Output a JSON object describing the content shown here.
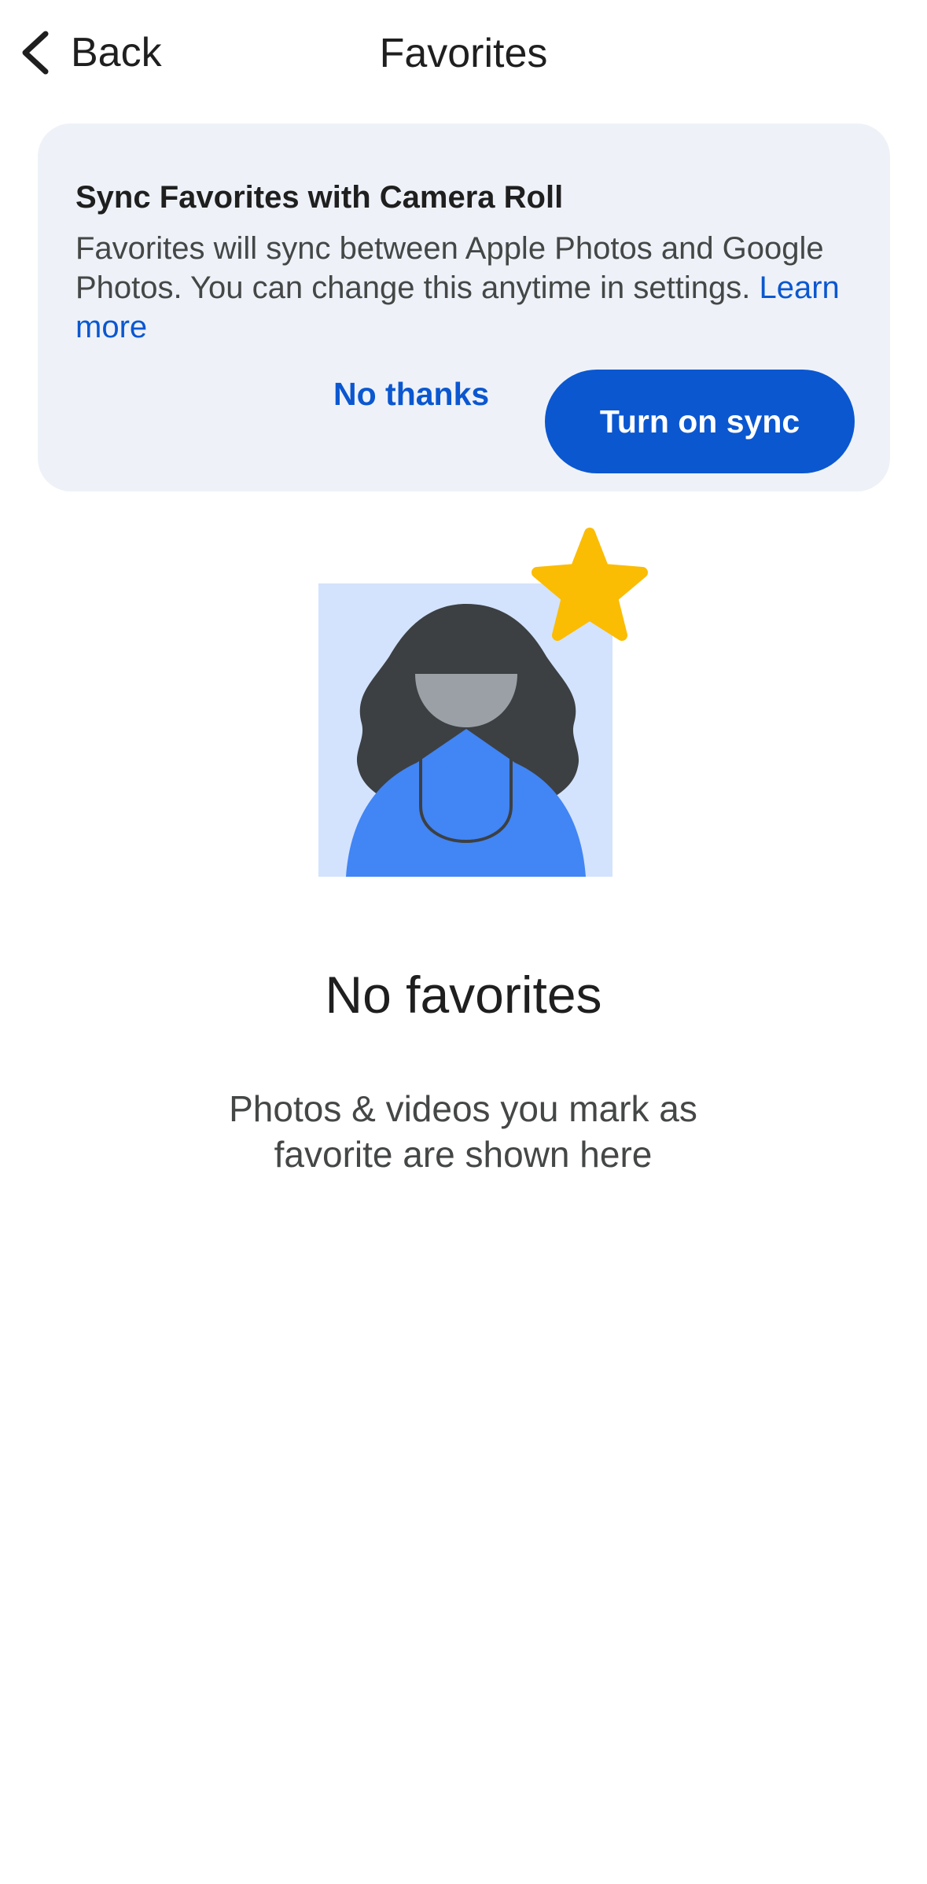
{
  "header": {
    "back_label": "Back",
    "back_icon": "chevron-left-icon",
    "title": "Favorites"
  },
  "sync_card": {
    "title": "Sync Favorites with Camera Roll",
    "body": "Favorites will sync between Apple Photos and Google Photos. You can change this anytime in settings.",
    "learn_more": "Learn more",
    "dismiss_label": "No thanks",
    "confirm_label": "Turn on sync"
  },
  "illustration": {
    "icon": "favorite-person-star-icon"
  },
  "empty_state": {
    "title": "No favorites",
    "subtitle": "Photos & videos you mark as favorite are shown here"
  },
  "colors": {
    "accent": "#0b57d0",
    "card_background": "#eef2f8",
    "star": "#fbbc04",
    "illustration_background": "#d3e3fd",
    "shirt": "#4285f4",
    "hair": "#3c4043",
    "face": "#9aa0a6"
  }
}
